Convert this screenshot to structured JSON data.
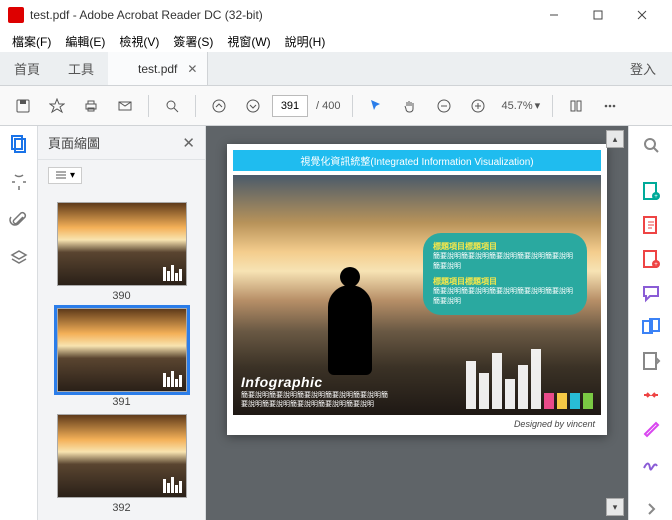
{
  "window": {
    "title": "test.pdf - Adobe Acrobat Reader DC (32-bit)"
  },
  "menu": {
    "file": "檔案(F)",
    "edit": "編輯(E)",
    "view": "檢視(V)",
    "sign": "簽署(S)",
    "window": "視窗(W)",
    "help": "說明(H)"
  },
  "tabs": {
    "home": "首頁",
    "tools": "工具",
    "doc": "test.pdf",
    "login": "登入"
  },
  "toolbar": {
    "page_current": "391",
    "page_total": "/ 400",
    "zoom": "45.7%"
  },
  "thumbnails": {
    "title": "頁面縮圖",
    "items": [
      {
        "label": "390"
      },
      {
        "label": "391",
        "selected": true
      },
      {
        "label": "392"
      }
    ]
  },
  "document": {
    "banner": "視覺化資訊統整(Integrated Information Visualization)",
    "bubble": {
      "title1": "標題項目標題項目",
      "body1": "簡要說明簡要說明簡要說明簡要說明簡要說明簡要說明",
      "title2": "標題項目標題項目",
      "body2": "簡要說明簡要說明簡要說明簡要說明簡要說明簡要說明"
    },
    "infographic": {
      "title": "Infographic",
      "body": "簡要說明簡要說明簡要說明簡要說明簡要說明簡要說明簡要說明簡要說明簡要說明簡要說明"
    },
    "credit": "Designed by vincent"
  }
}
